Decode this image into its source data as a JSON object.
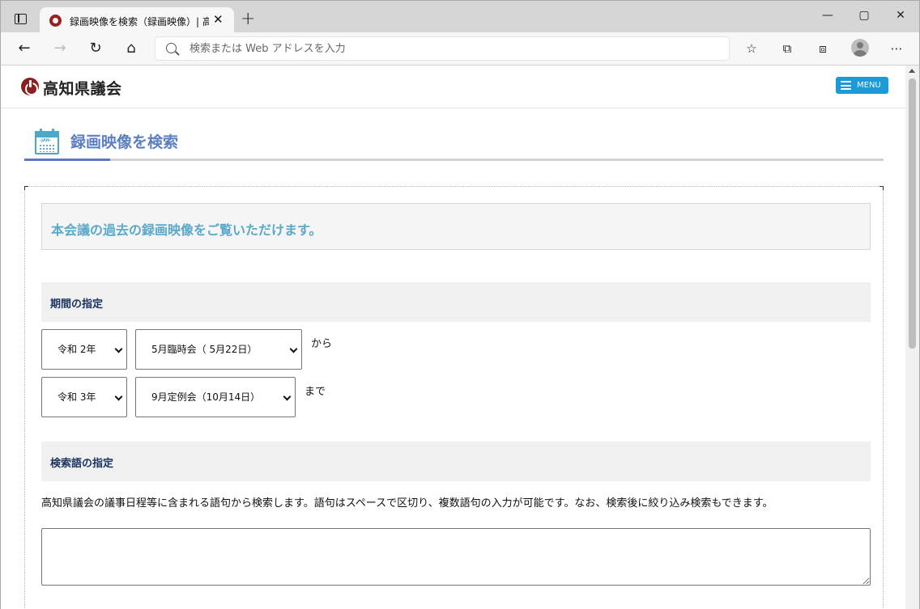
{
  "browser": {
    "tab_title": "録画映像を検索（録画映像）| 高知県議会",
    "tab_close": "✕",
    "new_tab": "+",
    "address_placeholder": "検索または Web アドレスを入力"
  },
  "site": {
    "logo_text": "高知県議会",
    "menu_label": "MENU"
  },
  "page": {
    "title": "録画映像を検索",
    "calendar_label": "-JAN-",
    "intro": "本会議の過去の録画映像をご覧いただけます。"
  },
  "period": {
    "heading": "期間の指定",
    "from_year": "令和 2年",
    "from_session": "5月臨時会（ 5月22日）",
    "from_suffix": "から",
    "to_year": "令和 3年",
    "to_session": "9月定例会（10月14日）",
    "to_suffix": "まで"
  },
  "keyword": {
    "heading": "検索語の指定",
    "description": "高知県議会の議事日程等に含まれる語句から検索します。語句はスペースで区切り、複数語句の入力が可能です。なお、検索後に絞り込み検索もできます。",
    "value": ""
  },
  "colors": {
    "brand_red": "#8a1f1f",
    "menu_blue": "#1a9ad6",
    "title_blue": "#5c7fc2",
    "intro_teal": "#5aa9c9",
    "section_navy": "#1c3461"
  }
}
